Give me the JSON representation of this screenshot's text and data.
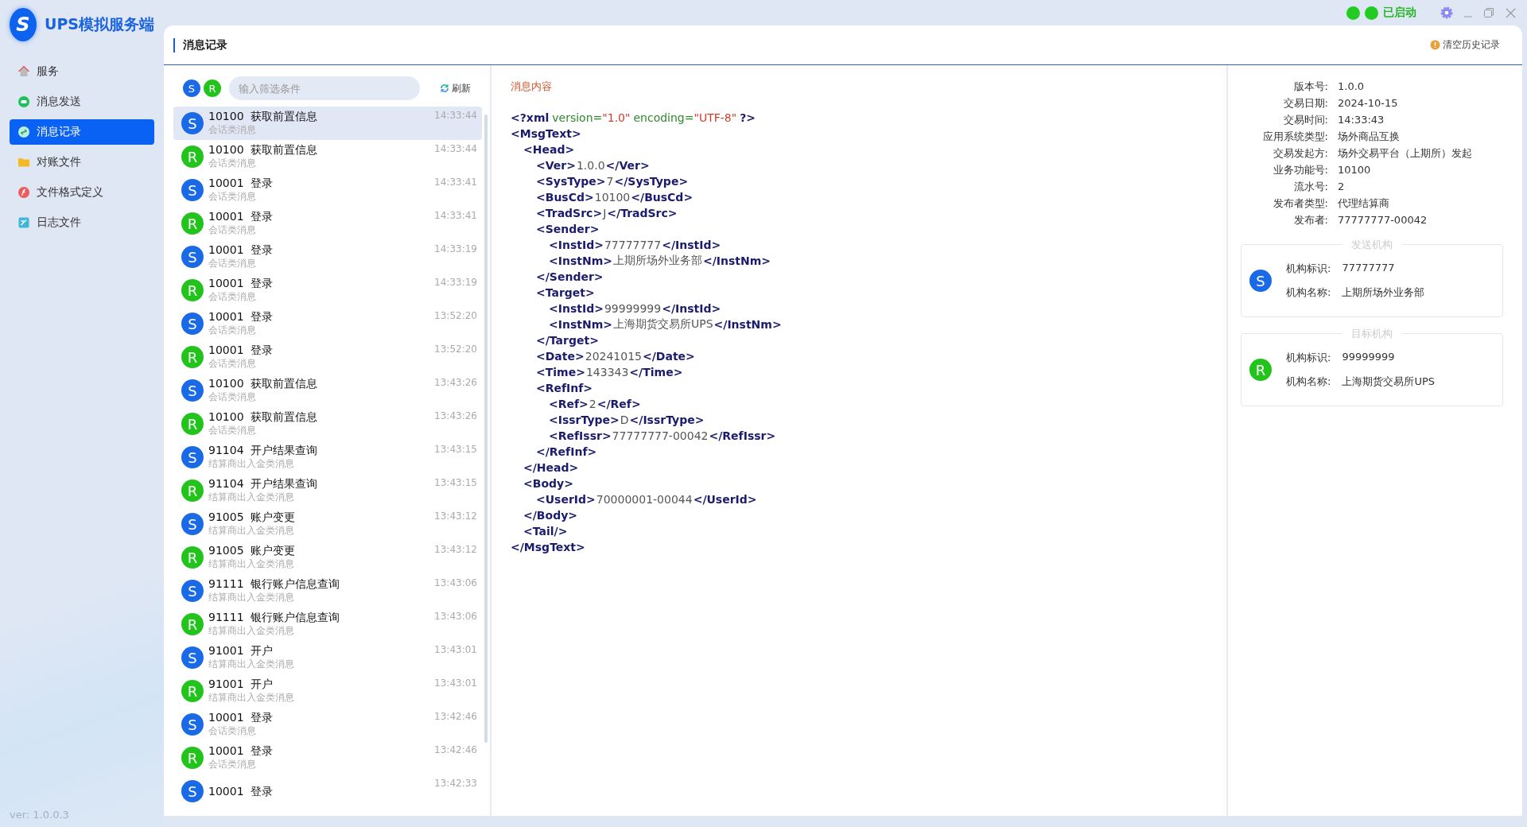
{
  "app": {
    "logo_letter": "S",
    "title": "UPS模拟服务端",
    "version": "ver: 1.0.0.3"
  },
  "title_bar": {
    "status": "已启动",
    "lights": [
      {
        "color": "#22cc22"
      },
      {
        "color": "#22cc22"
      }
    ]
  },
  "sidebar": {
    "items": [
      {
        "label": "服务",
        "selected": false
      },
      {
        "label": "消息发送",
        "selected": false
      },
      {
        "label": "消息记录",
        "selected": true
      },
      {
        "label": "对账文件",
        "selected": false
      },
      {
        "label": "文件格式定义",
        "selected": false
      },
      {
        "label": "日志文件",
        "selected": false
      }
    ]
  },
  "page": {
    "title": "消息记录",
    "clear_button": "清空历史记录"
  },
  "filter": {
    "chips": [
      {
        "kind": "send",
        "letter": "S"
      },
      {
        "kind": "receive",
        "letter": "R"
      }
    ],
    "placeholder": "输入筛选条件",
    "refresh": "刷新"
  },
  "messages": [
    {
      "kind": "send",
      "badge": "S",
      "code": "10100",
      "title": "获取前置信息",
      "category": "会话类消息",
      "time": "14:33:44",
      "selected": true
    },
    {
      "kind": "receive",
      "badge": "R",
      "code": "10100",
      "title": "获取前置信息",
      "category": "会话类消息",
      "time": "14:33:44",
      "selected": false
    },
    {
      "kind": "send",
      "badge": "S",
      "code": "10001",
      "title": "登录",
      "category": "会话类消息",
      "time": "14:33:41",
      "selected": false
    },
    {
      "kind": "receive",
      "badge": "R",
      "code": "10001",
      "title": "登录",
      "category": "会话类消息",
      "time": "14:33:41",
      "selected": false
    },
    {
      "kind": "send",
      "badge": "S",
      "code": "10001",
      "title": "登录",
      "category": "会话类消息",
      "time": "14:33:19",
      "selected": false
    },
    {
      "kind": "receive",
      "badge": "R",
      "code": "10001",
      "title": "登录",
      "category": "会话类消息",
      "time": "14:33:19",
      "selected": false
    },
    {
      "kind": "send",
      "badge": "S",
      "code": "10001",
      "title": "登录",
      "category": "会话类消息",
      "time": "13:52:20",
      "selected": false
    },
    {
      "kind": "receive",
      "badge": "R",
      "code": "10001",
      "title": "登录",
      "category": "会话类消息",
      "time": "13:52:20",
      "selected": false
    },
    {
      "kind": "send",
      "badge": "S",
      "code": "10100",
      "title": "获取前置信息",
      "category": "会话类消息",
      "time": "13:43:26",
      "selected": false
    },
    {
      "kind": "receive",
      "badge": "R",
      "code": "10100",
      "title": "获取前置信息",
      "category": "会话类消息",
      "time": "13:43:26",
      "selected": false
    },
    {
      "kind": "send",
      "badge": "S",
      "code": "91104",
      "title": "开户结果查询",
      "category": "结算商出入金类消息",
      "time": "13:43:15",
      "selected": false
    },
    {
      "kind": "receive",
      "badge": "R",
      "code": "91104",
      "title": "开户结果查询",
      "category": "结算商出入金类消息",
      "time": "13:43:15",
      "selected": false
    },
    {
      "kind": "send",
      "badge": "S",
      "code": "91005",
      "title": "账户变更",
      "category": "结算商出入金类消息",
      "time": "13:43:12",
      "selected": false
    },
    {
      "kind": "receive",
      "badge": "R",
      "code": "91005",
      "title": "账户变更",
      "category": "结算商出入金类消息",
      "time": "13:43:12",
      "selected": false
    },
    {
      "kind": "send",
      "badge": "S",
      "code": "91111",
      "title": "银行账户信息查询",
      "category": "结算商出入金类消息",
      "time": "13:43:06",
      "selected": false
    },
    {
      "kind": "receive",
      "badge": "R",
      "code": "91111",
      "title": "银行账户信息查询",
      "category": "结算商出入金类消息",
      "time": "13:43:06",
      "selected": false
    },
    {
      "kind": "send",
      "badge": "S",
      "code": "91001",
      "title": "开户",
      "category": "结算商出入金类消息",
      "time": "13:43:01",
      "selected": false
    },
    {
      "kind": "receive",
      "badge": "R",
      "code": "91001",
      "title": "开户",
      "category": "结算商出入金类消息",
      "time": "13:43:01",
      "selected": false
    },
    {
      "kind": "send",
      "badge": "S",
      "code": "10001",
      "title": "登录",
      "category": "会话类消息",
      "time": "13:42:46",
      "selected": false
    },
    {
      "kind": "receive",
      "badge": "R",
      "code": "10001",
      "title": "登录",
      "category": "会话类消息",
      "time": "13:42:46",
      "selected": false
    },
    {
      "kind": "send",
      "badge": "S",
      "code": "10001",
      "title": "登录",
      "time": "13:42:33",
      "selected": false
    }
  ],
  "content": {
    "title": "消息内容",
    "declaration": [
      {
        "kind": "punct",
        "text": "<?xml"
      },
      {
        "kind": "attr",
        "text": "version="
      },
      {
        "kind": "string",
        "text": "\"1.0\""
      },
      {
        "kind": "attr",
        "text": "encoding="
      },
      {
        "kind": "string",
        "text": "\"UTF-8\""
      },
      {
        "kind": "punct",
        "text": "?>"
      }
    ],
    "xml": [
      {
        "open": "<MsgText>",
        "close": "</MsgText>",
        "children": [
          {
            "open": "<Head>",
            "close": "</Head>",
            "children": [
              {
                "open": "<Ver>",
                "value": "1.0.0",
                "close": "</Ver>"
              },
              {
                "open": "<SysType>",
                "value": "7",
                "close": "</SysType>"
              },
              {
                "open": "<BusCd>",
                "value": "10100",
                "close": "</BusCd>"
              },
              {
                "open": "<TradSrc>",
                "value": "J",
                "close": "</TradSrc>"
              },
              {
                "open": "<Sender>",
                "close": "</Sender>",
                "children": [
                  {
                    "open": "<InstId>",
                    "value": "77777777",
                    "close": "</InstId>"
                  },
                  {
                    "open": "<InstNm>",
                    "value": "上期所场外业务部",
                    "close": "</InstNm>"
                  }
                ]
              },
              {
                "open": "<Target>",
                "close": "</Target>",
                "children": [
                  {
                    "open": "<InstId>",
                    "value": "99999999",
                    "close": "</InstId>"
                  },
                  {
                    "open": "<InstNm>",
                    "value": "上海期货交易所UPS",
                    "close": "</InstNm>"
                  }
                ]
              },
              {
                "open": "<Date>",
                "value": "20241015",
                "close": "</Date>"
              },
              {
                "open": "<Time>",
                "value": "143343",
                "close": "</Time>"
              },
              {
                "open": "<RefInf>",
                "close": "</RefInf>",
                "children": [
                  {
                    "open": "<Ref>",
                    "value": "2",
                    "close": "</Ref>"
                  },
                  {
                    "open": "<IssrType>",
                    "value": "D",
                    "close": "</IssrType>"
                  },
                  {
                    "open": "<RefIssr>",
                    "value": "77777777-00042",
                    "close": "</RefIssr>"
                  }
                ]
              }
            ]
          },
          {
            "open": "<Body>",
            "close": "</Body>",
            "children": [
              {
                "open": "<UserId>",
                "value": "70000001-00044",
                "close": "</UserId>"
              }
            ]
          },
          {
            "open": "<Tail/>"
          }
        ]
      }
    ]
  },
  "details": {
    "fields": [
      {
        "label": "版本号:",
        "value": "1.0.0"
      },
      {
        "label": "交易日期:",
        "value": "2024-10-15"
      },
      {
        "label": "交易时间:",
        "value": "14:33:43"
      },
      {
        "label": "应用系统类型:",
        "value": "场外商品互换"
      },
      {
        "label": "交易发起方:",
        "value": "场外交易平台（上期所）发起"
      },
      {
        "label": "业务功能号:",
        "value": "10100"
      },
      {
        "label": "流水号:",
        "value": "2"
      },
      {
        "label": "发布者类型:",
        "value": "代理结算商"
      },
      {
        "label": "发布者:",
        "value": "77777777-00042"
      }
    ],
    "institutions": [
      {
        "legend": "发送机构",
        "kind": "send",
        "badge": "S",
        "id_label": "机构标识:",
        "id": "77777777",
        "name_label": "机构名称:",
        "name": "上期所场外业务部"
      },
      {
        "legend": "目标机构",
        "kind": "receive",
        "badge": "R",
        "id_label": "机构标识:",
        "id": "99999999",
        "name_label": "机构名称:",
        "name": "上海期货交易所UPS"
      }
    ]
  }
}
